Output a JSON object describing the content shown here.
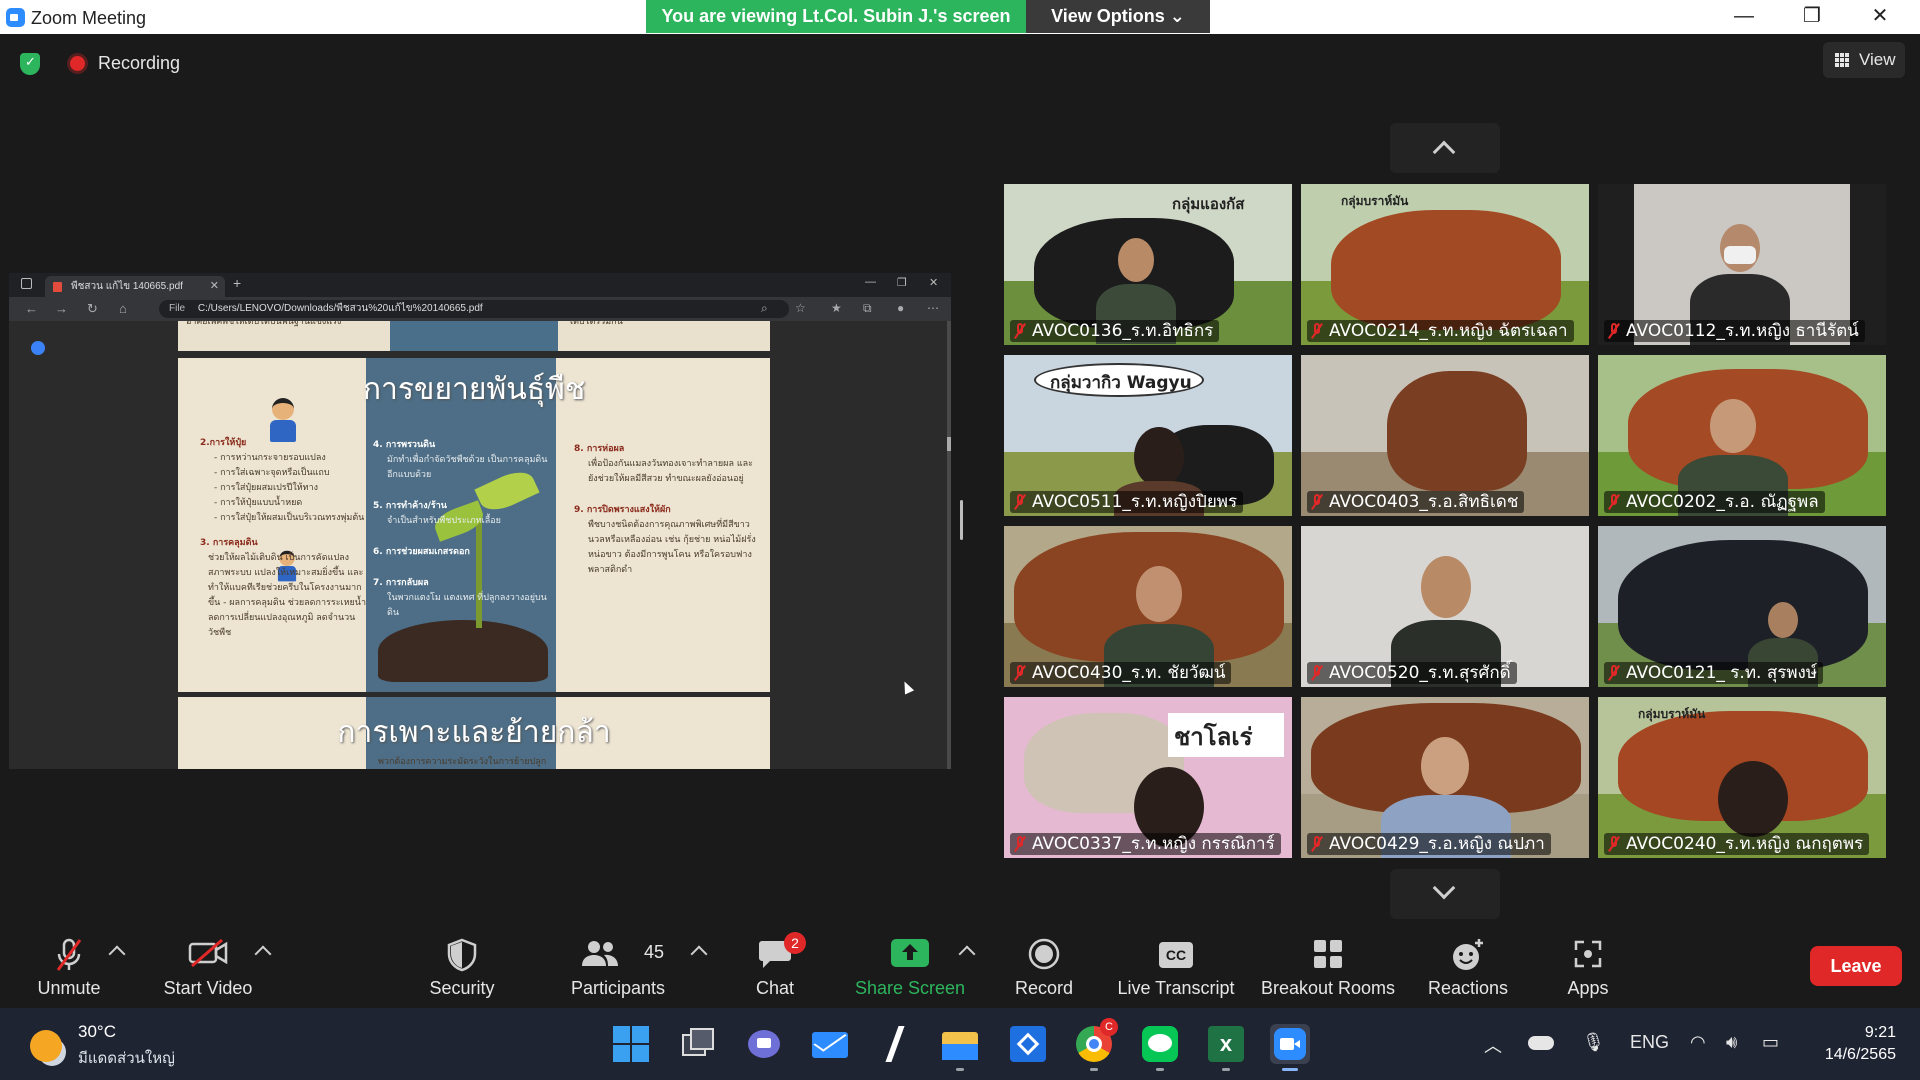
{
  "window": {
    "title": "Zoom Meeting",
    "viewing_banner": "You are viewing Lt.Col. Subin J.'s screen",
    "view_options": "View Options ⌄",
    "controls": [
      "—",
      "❐",
      "✕"
    ]
  },
  "status": {
    "recording_label": "Recording"
  },
  "gallery_view_button": "View",
  "shared_screen": {
    "tab_title": "พืชสวน แก้ไข 140665.pdf",
    "tab_close": "✕",
    "new_tab": "+",
    "address_prefix": "File",
    "address": "C:/Users/LENOVO/Downloads/พืชสวน%20แก้ไข%20140665.pdf",
    "prev_page_left": "อาศัยเพศพืชให้เติบโตบนพื้นฐานแข็งแรง",
    "prev_page_right": "เติบโตรวมกัน",
    "slide_title": "การขยายพันธุ์พืช",
    "col1": [
      {
        "h": "2.การให้ปุ๋ย",
        "t": "- การหว่านกระจายรอบแปลง\n- การใส่เฉพาะจุดหรือเป็นแถบ\n- การใส่ปุ๋ยผสมเปรปีให้ทาง\n- การให้ปุ๋ยแบบน้ำหยด\n- การใส่ปุ๋ยให้ผสมเป็นบริเวณทรงพุ่มต้น"
      },
      {
        "h": "3. การคลุมดิน",
        "t": "ช่วยให้ผลไม้เติบดิน เป็นการคัดแปลง สภาพระบบ แปลงให้เหมาะสมยิ่งขึ้น และทำให้แบคทีเรียช่วยครีบในโครงงานมากขึ้น - ผลการคลุมดิน ช่วยลดการระเหยน้ำ ลดการเปลี่ยนแปลงอุณหภูมิ ลดจำนวนวัชพืช"
      }
    ],
    "col2": [
      {
        "h": "4. การพรวนดิน",
        "t": "มักทำเพื่อกำจัดวัชพืชด้วย เป็นการคลุมดินอีกแบบด้วย"
      },
      {
        "h": "5. การทำค้าง/ร้าน",
        "t": "จำเป็นสำหรับพืชประเภทเลื้อย"
      },
      {
        "h": "6. การช่วยผสมเกสรดอก",
        "t": ""
      },
      {
        "h": "7. การกลับผล",
        "t": "ในพวกแตงโม แตงเทศ ที่ปลูกลงวางอยู่บนดิน"
      }
    ],
    "col3": [
      {
        "h": "8. การห่อผล",
        "t": "เพื่อป้องกันแมลงวันทองเจาะทำลายผล และยังช่วยให้ผลมีสีสวย ทำขณะผลยังอ่อนอยู่"
      },
      {
        "h": "9. การปิดพรางแสงให้ผัก",
        "t": "พืชบางชนิดต้องการคุณภาพพิเศษที่มีสีขาวนวลหรือเหลืองอ่อน เช่น กุ้ยช่าย หน่อไม้ฝรั่ง หน่อขาว ต้องมีการพูนโคน หรือใครอบฟางพลาสติกดำ"
      }
    ],
    "next_slide_title": "การเพาะและย้ายกล้า",
    "next_slide_sub": "พวกต้องการความระมัดระวังในการย้ายปลูก"
  },
  "participants_tiles": [
    {
      "name": "AVOC0136_ร.ท.อิทธิกร",
      "banner": "กลุ่มแองกัส"
    },
    {
      "name": "AVOC0214_ร.ท.หญิง ฉัตรเฉลา",
      "banner": "กลุ่มบราห์มัน"
    },
    {
      "name": "AVOC0112_ร.ท.หญิง ธานีรัตน์",
      "banner": ""
    },
    {
      "name": "AVOC0511_ร.ท.หญิงปิยพร",
      "banner": "กลุ่มวากิว Wagyu"
    },
    {
      "name": "AVOC0403_ร.อ.สิทธิเดช",
      "banner": ""
    },
    {
      "name": "AVOC0202_ร.อ. ณัฏฐพล",
      "banner": ""
    },
    {
      "name": "AVOC0430_ร.ท. ชัยวัฒน์",
      "banner": ""
    },
    {
      "name": "AVOC0520_ร.ท.สุรศักดิ์",
      "banner": ""
    },
    {
      "name": "AVOC0121_ ร.ท. สุรพงษ์",
      "banner": ""
    },
    {
      "name": "AVOC0337_ร.ท.หญิง กรรณิการ์",
      "banner": "ชาโลเร่"
    },
    {
      "name": "AVOC0429_ร.อ.หญิง ณปภา",
      "banner": ""
    },
    {
      "name": "AVOC0240_ร.ท.หญิง ณกฤตพร",
      "banner": "กลุ่มบราห์มัน"
    }
  ],
  "toolbar": {
    "unmute": "Unmute",
    "start_video": "Start Video",
    "security": "Security",
    "participants": "Participants",
    "participants_count": "45",
    "chat": "Chat",
    "chat_badge": "2",
    "share_screen": "Share Screen",
    "record": "Record",
    "live_transcript": "Live Transcript",
    "cc_glyph": "CC",
    "breakout_rooms": "Breakout Rooms",
    "reactions": "Reactions",
    "apps": "Apps",
    "leave": "Leave"
  },
  "taskbar": {
    "temperature": "30°C",
    "weather": "มีแดดส่วนใหญ่",
    "chrome_badge": "C",
    "language": "ENG",
    "time": "9:21",
    "date": "14/6/2565"
  },
  "colors": {
    "banner_green": "#2db55d",
    "leave_red": "#e02828",
    "share_green": "#2db55d",
    "zoom_blue": "#2d8cff"
  }
}
